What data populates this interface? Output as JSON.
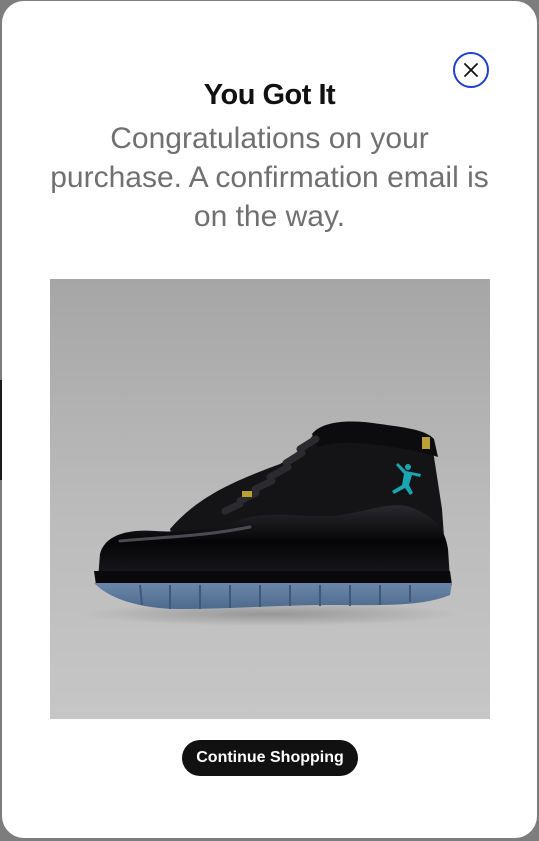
{
  "modal": {
    "title": "You Got It",
    "subtitle": "Congratulations on your purchase. A confirmation email is on the way.",
    "close_icon": "close-icon",
    "continue_label": "Continue Shopping"
  },
  "product": {
    "image_alt": "Black high-top sneaker with patent leather and icy blue sole"
  },
  "colors": {
    "close_ring": "#1f3fd1",
    "subtitle_text": "#707072",
    "button_bg": "#111111",
    "logo_accent": "#1aa6b0"
  }
}
